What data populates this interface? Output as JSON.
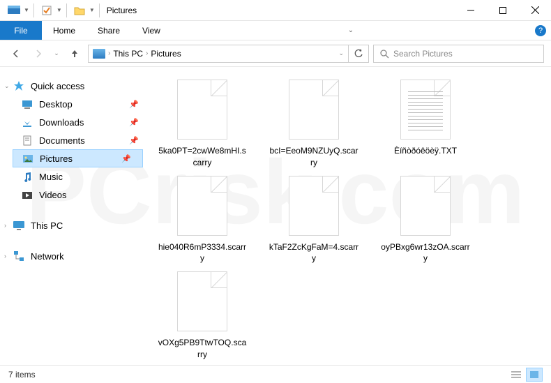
{
  "title": "Pictures",
  "ribbon": {
    "file": "File",
    "tabs": [
      "Home",
      "Share",
      "View"
    ]
  },
  "breadcrumb": {
    "part0": "This PC",
    "part1": "Pictures"
  },
  "search": {
    "placeholder": "Search Pictures"
  },
  "sidebar": {
    "quickaccess": {
      "label": "Quick access",
      "items": [
        {
          "label": "Desktop",
          "pinned": true,
          "selected": false
        },
        {
          "label": "Downloads",
          "pinned": true,
          "selected": false
        },
        {
          "label": "Documents",
          "pinned": true,
          "selected": false
        },
        {
          "label": "Pictures",
          "pinned": true,
          "selected": true
        },
        {
          "label": "Music",
          "pinned": false,
          "selected": false
        },
        {
          "label": "Videos",
          "pinned": false,
          "selected": false
        }
      ]
    },
    "thispc": {
      "label": "This PC"
    },
    "network": {
      "label": "Network"
    }
  },
  "files": [
    {
      "name": "5ka0PT=2cwWe8mHI.scarry",
      "type": "blank"
    },
    {
      "name": "bcI=EeoM9NZUyQ.scarry",
      "type": "blank"
    },
    {
      "name": "Èíñòðóêöèÿ.TXT",
      "type": "txt"
    },
    {
      "name": "hie040R6mP3334.scarry",
      "type": "blank"
    },
    {
      "name": "kTaF2ZcKgFaM=4.scarry",
      "type": "blank"
    },
    {
      "name": "oyPBxg6wr13zOA.scarry",
      "type": "blank"
    },
    {
      "name": "vOXg5PB9TtwTOQ.scarry",
      "type": "blank"
    }
  ],
  "status": {
    "item_count": "7 items"
  }
}
